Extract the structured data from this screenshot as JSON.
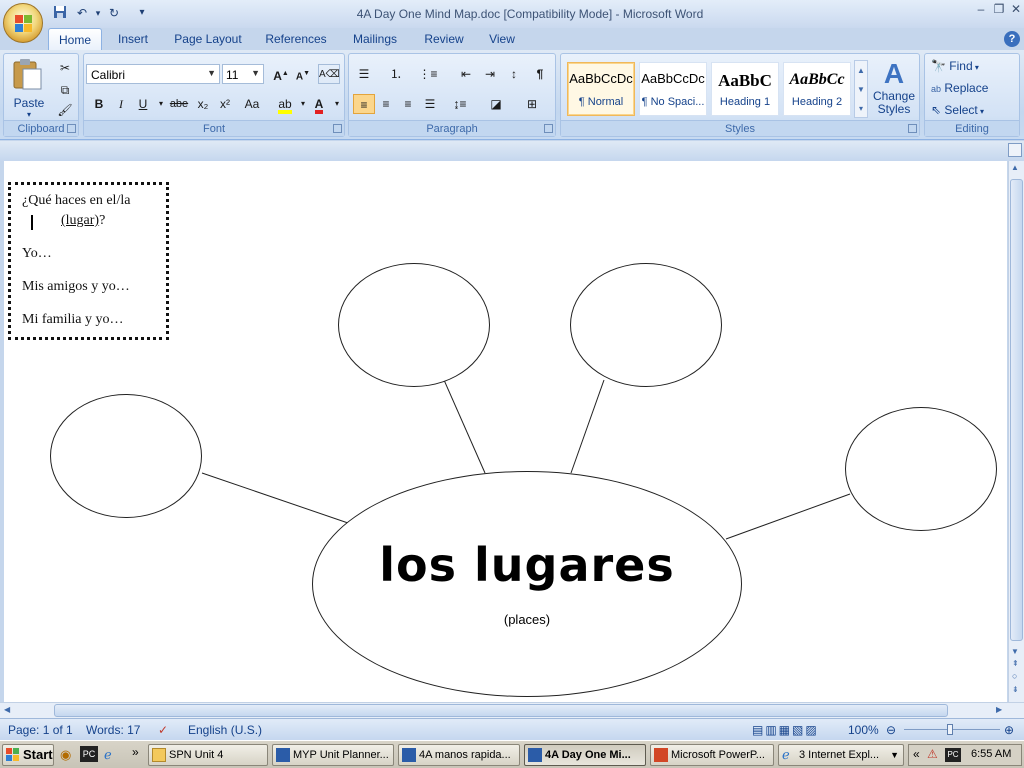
{
  "window": {
    "title": "4A Day One Mind Map.doc [Compatibility Mode] - Microsoft Word",
    "controls": [
      "–",
      "❐",
      "✕"
    ]
  },
  "ribbon": {
    "tabs": [
      "Home",
      "Insert",
      "Page Layout",
      "References",
      "Mailings",
      "Review",
      "View"
    ],
    "active_tab": "Home",
    "clipboard": {
      "paste_label": "Paste",
      "group_label": "Clipboard"
    },
    "font": {
      "font_name": "Calibri",
      "font_size": "11",
      "group_label": "Font",
      "buttons": [
        "B",
        "I",
        "U",
        "abe",
        "x₂",
        "x²",
        "Aa"
      ]
    },
    "paragraph": {
      "group_label": "Paragraph"
    },
    "styles": {
      "group_label": "Styles",
      "tiles": [
        {
          "sample": "AaBbCcDc",
          "name": "¶ Normal"
        },
        {
          "sample": "AaBbCcDc",
          "name": "¶ No Spaci..."
        },
        {
          "sample": "AaBbC",
          "name": "Heading 1"
        },
        {
          "sample": "AaBbCc",
          "name": "Heading 2"
        }
      ],
      "change_styles": [
        "Change",
        "Styles"
      ]
    },
    "editing": {
      "group_label": "Editing",
      "find": "Find",
      "replace": "Replace",
      "select": "Select"
    }
  },
  "document": {
    "prompt_box": {
      "line1": "¿Qué haces en el/la",
      "line2": "(lugar)",
      "line2_suffix": "?",
      "line3": "Yo…",
      "line4": "Mis amigos y yo…",
      "line5": "Mi familia y yo…"
    },
    "center_title": "los lugares",
    "center_subtitle": "(places)"
  },
  "status": {
    "page": "Page: 1 of 1",
    "words": "Words: 17",
    "language": "English (U.S.)",
    "zoom": "100%"
  },
  "taskbar": {
    "start": "Start",
    "tasks": [
      {
        "label": "SPN Unit 4",
        "active": false
      },
      {
        "label": "MYP Unit Planner...",
        "active": false
      },
      {
        "label": "4A manos rapida...",
        "active": false
      },
      {
        "label": "4A Day One Mi...",
        "active": true
      },
      {
        "label": "Microsoft PowerP...",
        "active": false
      },
      {
        "label": "3 Internet Expl...",
        "active": false
      }
    ],
    "clock": "6:55 AM"
  },
  "colors": {
    "ribbon_text": "#15428b",
    "accent_gold": "#f0b85a",
    "doc_background": "#ffffff"
  }
}
